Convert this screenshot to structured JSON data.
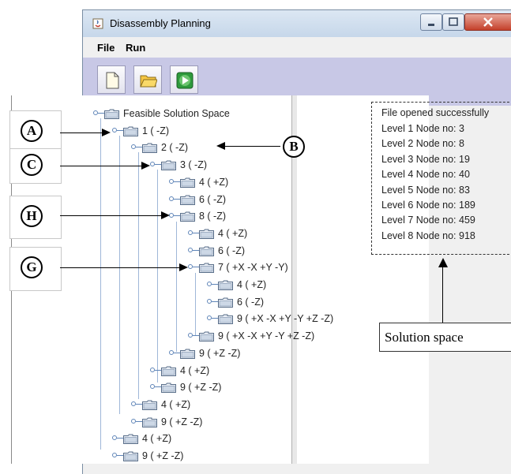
{
  "window": {
    "title": "Disassembly Planning",
    "menu": [
      "File",
      "Run"
    ],
    "toolbar": [
      {
        "icon": "new-file-icon"
      },
      {
        "icon": "open-folder-icon"
      },
      {
        "icon": "run-icon"
      }
    ]
  },
  "tree": {
    "nodes": [
      {
        "label": "Feasible Solution Space",
        "depth": 0
      },
      {
        "label": "1 ( -Z)",
        "depth": 1
      },
      {
        "label": "2 ( -Z)",
        "depth": 2
      },
      {
        "label": "3 ( -Z)",
        "depth": 3
      },
      {
        "label": "4 ( +Z)",
        "depth": 4
      },
      {
        "label": "6 ( -Z)",
        "depth": 4
      },
      {
        "label": "8 ( -Z)",
        "depth": 4
      },
      {
        "label": "4 ( +Z)",
        "depth": 5
      },
      {
        "label": "6 ( -Z)",
        "depth": 5
      },
      {
        "label": "7 ( +X -X +Y -Y)",
        "depth": 5
      },
      {
        "label": "4 ( +Z)",
        "depth": 6
      },
      {
        "label": "6 ( -Z)",
        "depth": 6
      },
      {
        "label": "9 ( +X -X +Y -Y +Z -Z)",
        "depth": 6
      },
      {
        "label": "9 ( +X -X +Y -Y +Z -Z)",
        "depth": 5
      },
      {
        "label": "9 ( +Z -Z)",
        "depth": 4
      },
      {
        "label": "4 ( +Z)",
        "depth": 3
      },
      {
        "label": "9 ( +Z -Z)",
        "depth": 3
      },
      {
        "label": "4 ( +Z)",
        "depth": 2
      },
      {
        "label": "9 ( +Z -Z)",
        "depth": 2
      },
      {
        "label": "4 ( +Z)",
        "depth": 1
      },
      {
        "label": "9 ( +Z -Z)",
        "depth": 1
      }
    ]
  },
  "info": {
    "lines": [
      "File opened successfully",
      "Level 1 Node no: 3",
      "Level 2 Node no: 8",
      "Level 3 Node no: 19",
      "Level 4 Node no: 40",
      "Level 5 Node no: 83",
      "Level 6 Node no: 189",
      "Level 7 Node no: 459",
      "Level 8 Node no: 918"
    ]
  },
  "annotations": {
    "callouts": [
      "A",
      "B",
      "C",
      "H",
      "G"
    ],
    "solution_label": "Solution space"
  }
}
